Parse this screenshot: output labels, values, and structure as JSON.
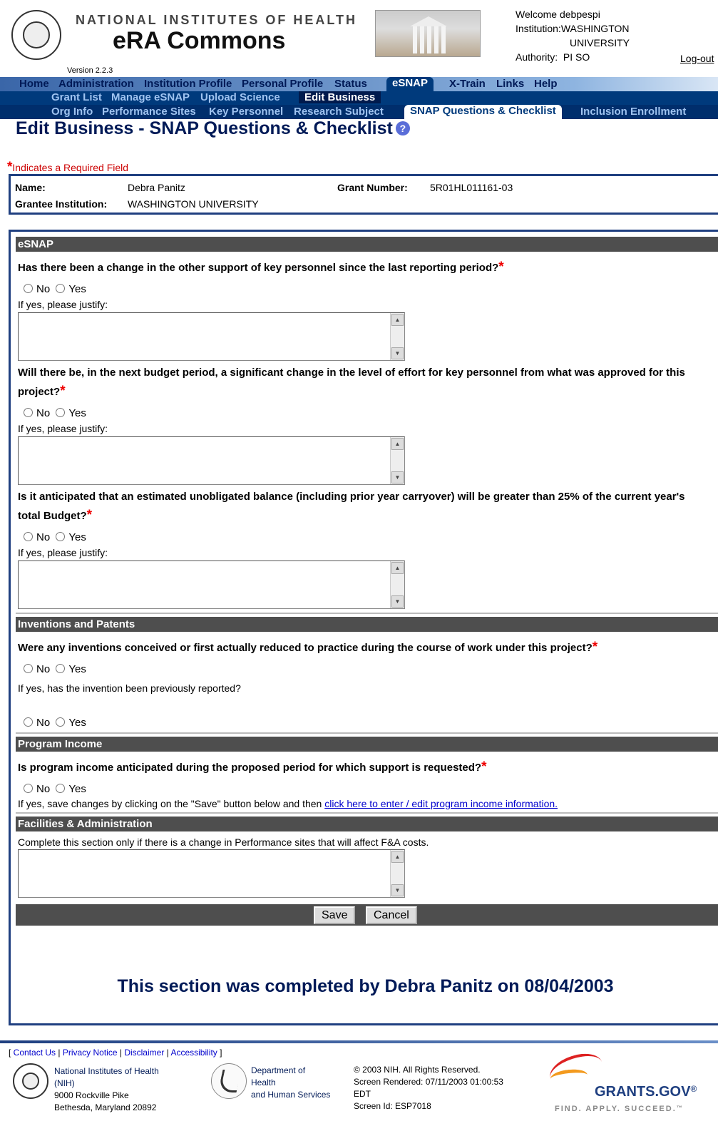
{
  "header": {
    "seal_text": "NATIONAL INSTITUTES OF HEALTH",
    "agency": "NATIONAL INSTITUTES OF HEALTH",
    "app_name": "eRA Commons",
    "version": "Version 2.2.3",
    "welcome_label": "Welcome",
    "user": "debpespi",
    "institution_label": "Institution:",
    "institution_1": "WASHINGTON",
    "institution_2": "UNIVERSITY",
    "authority_label": "Authority:",
    "authority": "PI SO",
    "logout": "Log-out"
  },
  "nav": {
    "primary": [
      "Home",
      "Administration",
      "Institution Profile",
      "Personal Profile",
      "Status",
      "eSNAP",
      "X-Train",
      "Links",
      "Help"
    ],
    "secondary": [
      "Grant List",
      "Manage eSNAP",
      "Upload Science",
      "Edit Business"
    ],
    "tertiary": [
      "Org Info",
      "Performance Sites",
      "Key Personnel",
      "Research Subject",
      "SNAP Questions & Checklist",
      "Inclusion Enrollment"
    ]
  },
  "page": {
    "title": "Edit Business - SNAP Questions & Checklist",
    "help_icon": "?",
    "required_star": "*",
    "required_note": "Indicates a Required Field"
  },
  "info": {
    "name_label": "Name:",
    "name": "Debra Panitz",
    "grant_label": "Grant Number:",
    "grant": "5R01HL011161-03",
    "inst_label": "Grantee Institution:",
    "inst": "WASHINGTON UNIVERSITY"
  },
  "form": {
    "sections": {
      "esnap": "eSNAP",
      "inventions": "Inventions and Patents",
      "income": "Program Income",
      "fa": "Facilities & Administration"
    },
    "q1": "Has there been a change in the other support of key personnel since the last reporting period?",
    "q2_line1": "Will there be, in the next budget period, a significant change in the level of effort for key personnel from what was approved for this",
    "q2_line2": "project?",
    "q3_line1": "Is it anticipated that an estimated unobligated balance (including prior year carryover) will be greater than 25% of the current year's",
    "q3_line2": "total Budget?",
    "q4": "Were any inventions conceived or first actually reduced to practice during the course of work under this project?",
    "q4_sub": "If yes, has the invention been previously reported?",
    "q5": "Is program income anticipated during the proposed period for which support is requested?",
    "q5_note": "If yes, save changes by clicking on the \"Save\" button below and then",
    "q5_link": "click here to enter / edit program income information.",
    "fa_note": "Complete this section only if there is a change in Performance sites that will affect F&A costs.",
    "justify": "If yes, please justify:",
    "no": "No",
    "yes": "Yes",
    "save": "Save",
    "cancel": "Cancel",
    "completed": "This section was completed by Debra Panitz on 08/04/2003"
  },
  "footer": {
    "links": [
      "Contact Us",
      "Privacy Notice",
      "Disclaimer",
      "Accessibility"
    ],
    "nih_1": "National Institutes of Health",
    "nih_2": "(NIH)",
    "nih_3": "9000 Rockville Pike",
    "nih_4": "Bethesda, Maryland 20892",
    "hhs_1": "Department of",
    "hhs_2": "Health",
    "hhs_3": "and Human Services",
    "copy_1": "© 2003 NIH. All Rights Reserved.",
    "copy_2": "Screen Rendered: 07/11/2003 01:00:53",
    "copy_3": "EDT",
    "copy_4": "Screen Id: ESP7018",
    "grants": "GRANTS.GOV",
    "grants_tm": "®",
    "grants_tag": "FIND. APPLY. SUCCEED.",
    "grants_tag_tm": "™"
  }
}
